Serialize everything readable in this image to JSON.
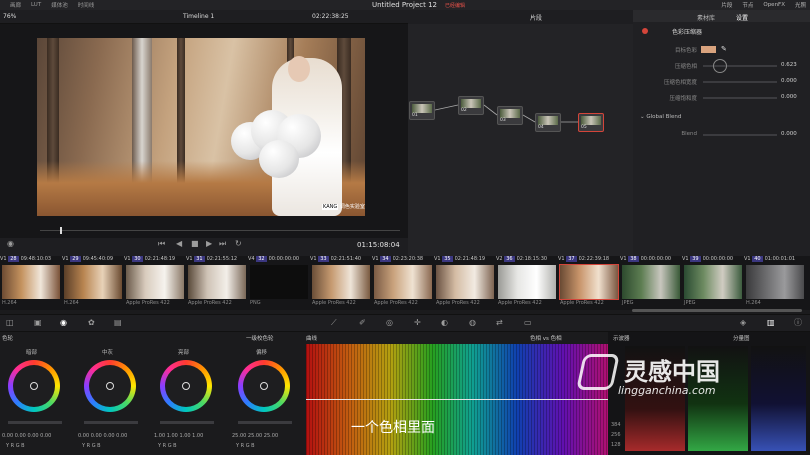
{
  "topbar": {
    "items": [
      "画廊",
      "LUT",
      "媒体池",
      "时间线"
    ],
    "project_title": "Untitled Project 12",
    "project_status": "已经编辑",
    "right_items": [
      "片段",
      "节点",
      "OpenFX",
      "光照"
    ]
  },
  "viewer": {
    "zoom": "76%",
    "timeline_name": "Timeline 1",
    "timecode": "02:22:38:25",
    "playhead_timecode": "01:15:08:04",
    "watermark_logo": "KANG",
    "watermark_text": "调色实验室"
  },
  "nodes": {
    "mode": "片段",
    "items": [
      {
        "label": "01"
      },
      {
        "label": "02"
      },
      {
        "label": "03"
      },
      {
        "label": "04"
      },
      {
        "label": "05"
      }
    ]
  },
  "inspector": {
    "tabs": [
      "素材库",
      "设置"
    ],
    "section_title": "色彩压缩器",
    "rows": [
      {
        "label": "目标色彩",
        "value": ""
      },
      {
        "label": "压缩色相",
        "value": "0.623"
      },
      {
        "label": "压缩色相宽度",
        "value": "0.000"
      },
      {
        "label": "压缩饱和度",
        "value": "0.000"
      }
    ],
    "global_blend_title": "Global Blend",
    "blend_label": "Blend",
    "blend_value": "0.000",
    "swatch_color": "#d9a37e"
  },
  "clips": [
    {
      "num": "28",
      "tc": "09:48:10:03",
      "track": "V1",
      "codec": "H.264"
    },
    {
      "num": "29",
      "tc": "09:45:40:09",
      "track": "V1",
      "codec": "H.264"
    },
    {
      "num": "30",
      "tc": "02:21:48:19",
      "track": "V1",
      "codec": "Apple ProRes 422"
    },
    {
      "num": "31",
      "tc": "02:21:55:12",
      "track": "V1",
      "codec": "Apple ProRes 422"
    },
    {
      "num": "32",
      "tc": "00:00:00:00",
      "track": "V4",
      "codec": "PNG"
    },
    {
      "num": "33",
      "tc": "02:21:51:40",
      "track": "V1",
      "codec": "Apple ProRes 422"
    },
    {
      "num": "34",
      "tc": "02:23:20:38",
      "track": "V1",
      "codec": "Apple ProRes 422"
    },
    {
      "num": "35",
      "tc": "02:21:48:19",
      "track": "V1",
      "codec": "Apple ProRes 422"
    },
    {
      "num": "36",
      "tc": "02:18:15:30",
      "track": "V2",
      "codec": "Apple ProRes 422"
    },
    {
      "num": "37",
      "tc": "02:22:39:18",
      "track": "V1",
      "codec": "Apple ProRes 422"
    },
    {
      "num": "38",
      "tc": "00:00:00:00",
      "track": "V1",
      "codec": "JPEG"
    },
    {
      "num": "39",
      "tc": "00:00:00:00",
      "track": "V1",
      "codec": "JPEG"
    },
    {
      "num": "40",
      "tc": "01:00:01:01",
      "track": "V1",
      "codec": "H.264"
    }
  ],
  "wheels_panel": {
    "title": "色轮",
    "mode": "一级校色轮",
    "wheels": [
      {
        "label": "暗部",
        "vals": "0.00  0.00  0.00  0.00"
      },
      {
        "label": "中灰",
        "vals": "0.00  0.00  0.00  0.00"
      },
      {
        "label": "亮部",
        "vals": "1.00  1.00  1.00  1.00"
      },
      {
        "label": "偏移",
        "vals": "25.00  25.00  25.00"
      }
    ],
    "channel_letters": "Y  R  G  B"
  },
  "curves_panel": {
    "title": "曲线",
    "mode": "色相 vs 色相"
  },
  "scope_panel": {
    "title": "示波器",
    "mode": "分量图",
    "ticks": [
      "384",
      "256",
      "128",
      "0"
    ]
  },
  "subtitle": "一个色相里面",
  "site_watermark": {
    "cn": "灵感中国",
    "url": "lingganchina.com"
  }
}
